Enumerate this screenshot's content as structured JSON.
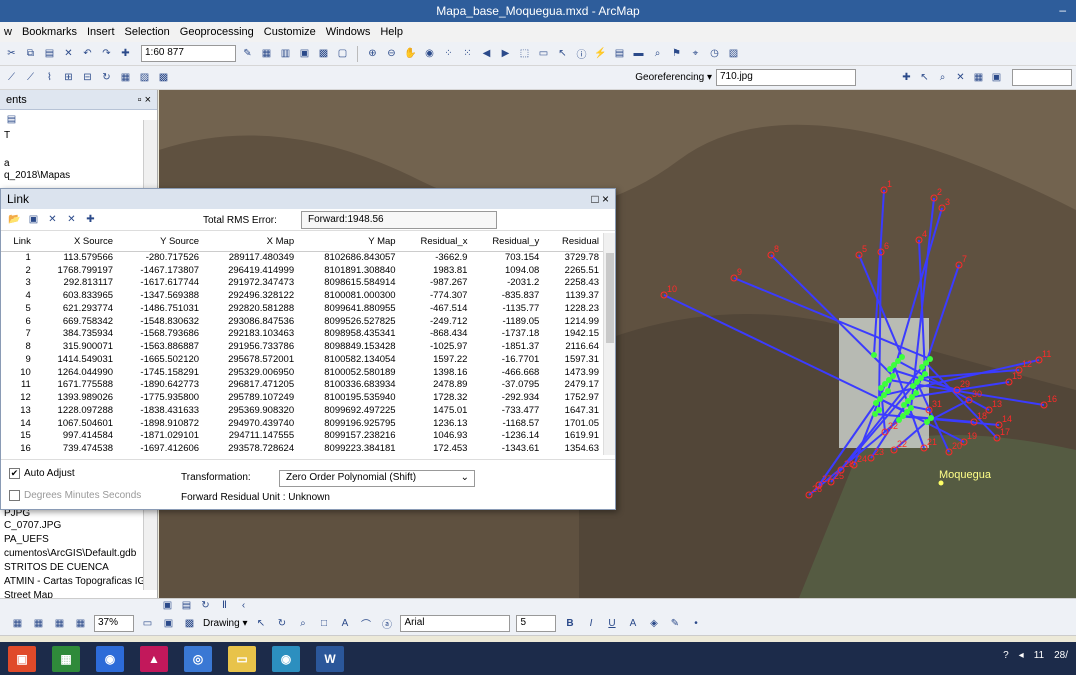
{
  "window": {
    "title": "Mapa_base_Moquegua.mxd - ArcMap",
    "minimize": "–"
  },
  "menu": [
    "w",
    "Bookmarks",
    "Insert",
    "Selection",
    "Geoprocessing",
    "Customize",
    "Windows",
    "Help"
  ],
  "toolbar": {
    "scale": "1:60 877"
  },
  "georef": {
    "label": "Georeferencing ▾",
    "layer": "710.jpg"
  },
  "toc": {
    "header": "ents",
    "close": "▫ ×",
    "lines_top": [
      "T",
      "a",
      "q_2018\\Mapas"
    ],
    "lines_bottom": [
      "PJPG",
      "C_0707.JPG",
      "PA_UEFS",
      "cumentos\\ArcGIS\\Default.gdb",
      "STRITOS DE CUENCA",
      "ATMIN - Cartas Topograficas IGI",
      "Street Map"
    ]
  },
  "link_dialog": {
    "title": "Link",
    "close_icons": "□ ×",
    "rms_label": "Total RMS Error:",
    "rms_value": "Forward:1948.56",
    "columns": [
      "Link",
      "X Source",
      "Y Source",
      "X Map",
      "Y Map",
      "Residual_x",
      "Residual_y",
      "Residual"
    ],
    "rows": [
      [
        "1",
        "113.579566",
        "-280.717526",
        "289117.480349",
        "8102686.843057",
        "-3662.9",
        "703.154",
        "3729.78"
      ],
      [
        "2",
        "1768.799197",
        "-1467.173807",
        "296419.414999",
        "8101891.308840",
        "1983.81",
        "1094.08",
        "2265.51"
      ],
      [
        "3",
        "292.813117",
        "-1617.617744",
        "291972.347473",
        "8098615.584914",
        "-987.267",
        "-2031.2",
        "2258.43"
      ],
      [
        "4",
        "603.833965",
        "-1347.569388",
        "292496.328122",
        "8100081.000300",
        "-774.307",
        "-835.837",
        "1139.37"
      ],
      [
        "5",
        "621.293774",
        "-1486.751031",
        "292820.581288",
        "8099641.880955",
        "-467.514",
        "-1135.77",
        "1228.23"
      ],
      [
        "6",
        "669.758342",
        "-1548.830632",
        "293086.847536",
        "8099526.527825",
        "-249.712",
        "-1189.05",
        "1214.99"
      ],
      [
        "7",
        "384.735934",
        "-1568.793686",
        "292183.103463",
        "8098958.435341",
        "-868.434",
        "-1737.18",
        "1942.15"
      ],
      [
        "8",
        "315.900071",
        "-1563.886887",
        "291956.733786",
        "8098849.153428",
        "-1025.97",
        "-1851.37",
        "2116.64"
      ],
      [
        "9",
        "1414.549031",
        "-1665.502120",
        "295678.572001",
        "8100582.134054",
        "1597.22",
        "-16.7701",
        "1597.31"
      ],
      [
        "10",
        "1264.044990",
        "-1745.158291",
        "295329.006950",
        "8100052.580189",
        "1398.16",
        "-466.668",
        "1473.99"
      ],
      [
        "11",
        "1671.775588",
        "-1890.642773",
        "296817.471205",
        "8100336.683934",
        "2478.89",
        "-37.0795",
        "2479.17"
      ],
      [
        "12",
        "1393.989026",
        "-1775.935800",
        "295789.107249",
        "8100195.535940",
        "1728.32",
        "-292.934",
        "1752.97"
      ],
      [
        "13",
        "1228.097288",
        "-1838.431633",
        "295369.908320",
        "8099692.497225",
        "1475.01",
        "-733.477",
        "1647.31"
      ],
      [
        "14",
        "1067.504601",
        "-1898.910872",
        "294970.439740",
        "8099196.925795",
        "1236.13",
        "-1168.57",
        "1701.05"
      ],
      [
        "15",
        "997.414584",
        "-1871.029101",
        "294711.147555",
        "8099157.238216",
        "1046.93",
        "-1236.14",
        "1619.91"
      ],
      [
        "16",
        "739.474538",
        "-1697.412606",
        "293578.728624",
        "8099223.384181",
        "172.453",
        "-1343.61",
        "1354.63"
      ]
    ],
    "auto_adjust": "Auto Adjust",
    "dms": "Degrees Minutes Seconds",
    "transformation_label": "Transformation:",
    "transformation_value": "Zero Order Polynomial (Shift)",
    "residual_unit": "Forward Residual Unit : Unknown"
  },
  "map": {
    "place_label": "Moquegua",
    "link_color": "#3b3bff",
    "point_color": "#ff2a2a",
    "point_labels": [
      "1",
      "2",
      "3",
      "4",
      "5",
      "6",
      "7",
      "8",
      "9",
      "10",
      "11",
      "12",
      "13",
      "14",
      "15",
      "16",
      "17",
      "18",
      "19",
      "20",
      "21",
      "22",
      "23",
      "24",
      "25",
      "26",
      "27",
      "28",
      "29",
      "30",
      "31",
      "32"
    ]
  },
  "drawing": {
    "label": "Drawing ▾",
    "font": "Arial",
    "size": "5",
    "zoom": "37%",
    "bold": "B",
    "italic": "I",
    "underline": "U",
    "font_color_letter": "A"
  },
  "tray": {
    "time": "11",
    "date": "28/"
  }
}
